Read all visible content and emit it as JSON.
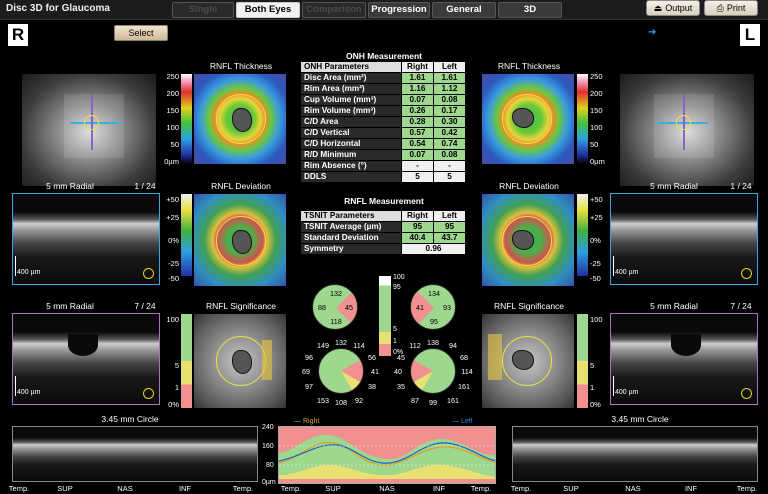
{
  "app": {
    "title": "Disc 3D for Glaucoma"
  },
  "tabs": [
    {
      "label": "Single"
    },
    {
      "label": "Both Eyes"
    },
    {
      "label": "Comparison"
    },
    {
      "label": "Progression"
    },
    {
      "label": "General"
    },
    {
      "label": "3D"
    }
  ],
  "toolbar": {
    "output_label": "Output",
    "print_label": "Print",
    "select_label": "Select"
  },
  "eyes": {
    "right": "R",
    "left": "L"
  },
  "labels": {
    "rnfl_thickness": "RNFL Thickness",
    "rnfl_deviation": "RNFL Deviation",
    "rnfl_significance": "RNFL Significance",
    "radial": "5 mm Radial",
    "radial_idx_1": "1 / 24",
    "radial_idx_2": "7 / 24",
    "circle": "3.45 mm Circle",
    "scale_400": "400 µm"
  },
  "scales": {
    "thick": [
      "250",
      "200",
      "150",
      "100",
      "50",
      "0µm"
    ],
    "dev": [
      "+50",
      "+25",
      "0%",
      "-25",
      "-50"
    ],
    "dev_l": [
      "+50",
      "+25",
      "0%",
      "-25",
      "-50"
    ],
    "sig": [
      "100",
      "5",
      "1",
      "0%"
    ]
  },
  "onh": {
    "title": "ONH Measurement",
    "headers": [
      "ONH Parameters",
      "Right",
      "Left"
    ],
    "rows": [
      [
        "Disc Area (mm²)",
        "1.61",
        "1.61"
      ],
      [
        "Rim Area (mm²)",
        "1.16",
        "1.12"
      ],
      [
        "Cup Volume (mm³)",
        "0.07",
        "0.08"
      ],
      [
        "Rim Volume (mm³)",
        "0.26",
        "0.17"
      ],
      [
        "C/D Area",
        "0.28",
        "0.30"
      ],
      [
        "C/D Vertical",
        "0.57",
        "0.42"
      ],
      [
        "C/D Horizontal",
        "0.54",
        "0.74"
      ],
      [
        "R/D Minimum",
        "0.07",
        "0.08"
      ],
      [
        "Rim Absence (°)",
        "-",
        "-"
      ],
      [
        "DDLS",
        "5",
        "5"
      ]
    ]
  },
  "tsnit": {
    "title": "RNFL Measurement",
    "headers": [
      "TSNIT Parameters",
      "Right",
      "Left"
    ],
    "rows": [
      [
        "TSNIT Average (µm)",
        "95",
        "95"
      ],
      [
        "Standard Deviation",
        "40.4",
        "43.7"
      ]
    ],
    "symmetry_label": "Symmetry",
    "symmetry_value": "0.96"
  },
  "quadrants": {
    "right": [
      "132",
      "88",
      "45",
      "118"
    ],
    "left": [
      "134",
      "41",
      "93",
      "95"
    ]
  },
  "clock_right": [
    "149",
    "132",
    "114",
    "96",
    "56",
    "69",
    "41",
    "97",
    "38",
    "153",
    "108",
    "92"
  ],
  "clock_left": [
    "112",
    "138",
    "94",
    "45",
    "68",
    "40",
    "114",
    "35",
    "161",
    "87",
    "99",
    "161"
  ],
  "legend_scale": [
    "100",
    "95",
    "5",
    "1",
    "0%"
  ],
  "tsnit_chart": {
    "legend": [
      "Right",
      "Left"
    ],
    "yticks": [
      "240",
      "160",
      "80",
      "0µm"
    ],
    "xticks": [
      "Temp.",
      "SUP",
      "NAS",
      "INF",
      "Temp."
    ]
  },
  "bscan_axis": [
    "Temp.",
    "SUP",
    "NAS",
    "INF",
    "Temp."
  ],
  "colors": {
    "green": "#9ed88e",
    "yellow": "#e8e070",
    "red": "#f09090"
  }
}
